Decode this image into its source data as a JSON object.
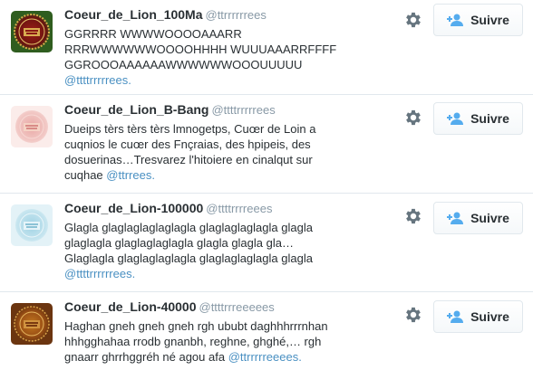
{
  "users": [
    {
      "name": "Coeur_de_Lion_100Ma",
      "handle": "@ttrrrrrrees",
      "bio_lines": [
        "GGRRRR WWWWOOOOAAARR",
        "RRRWWWWWWOOOOHHHH WUUUAAARRFFFF",
        "GGROOOAAAAAAWWWWWWOOOUUUUU"
      ],
      "mention": "@ttttrrrrrees.",
      "avatar_style": "vivid",
      "follow_label": "Suivre"
    },
    {
      "name": "Coeur_de_Lion_B-Bang",
      "handle": "@ttttrrrrrees",
      "bio_lines": [
        "Dueips tèrs tèrs tèrs lmnogetps, Cuœr de Loin a",
        "cuqnios le cuœr des Fnçraias, des hpipeis, des",
        "dosuerinas…Tresvarez l'hitoiere en cinalqut sur",
        "cuqhae"
      ],
      "mention": "@ttrrees.",
      "avatar_style": "pink",
      "follow_label": "Suivre"
    },
    {
      "name": "Coeur_de_Lion-100000",
      "handle": "@ttttrrrreees",
      "bio_lines": [
        "Glagla glaglaglaglaglagla glaglaglaglagla glagla",
        "glaglagla glaglaglaglagla glagla glagla gla…",
        "Glaglagla glaglaglaglagla glaglaglaglagla glagla"
      ],
      "mention": "@ttttrrrrrrees.",
      "avatar_style": "icy",
      "follow_label": "Suivre"
    },
    {
      "name": "Coeur_de_Lion-40000",
      "handle": "@ttttrrreeeees",
      "bio_lines": [
        "Haghan gneh gneh gneh rgh ububt daghhhrrrnhan",
        "hhhgghahaa rrodb gnanbh, reghne, ghghé,… rgh",
        "gnaarr ghrrhggréh né agou afa"
      ],
      "mention": "@ttrrrrreeees.",
      "avatar_style": "bronze",
      "follow_label": "Suivre"
    }
  ],
  "colors": {
    "text": "#292f33",
    "handle": "#8899a6",
    "link": "#4a90c2",
    "follow_icon": "#55acee",
    "gear": "#66757f",
    "divider": "#e1e8ed"
  },
  "icons": {
    "settings": "gear-icon",
    "follow": "add-user-icon"
  }
}
